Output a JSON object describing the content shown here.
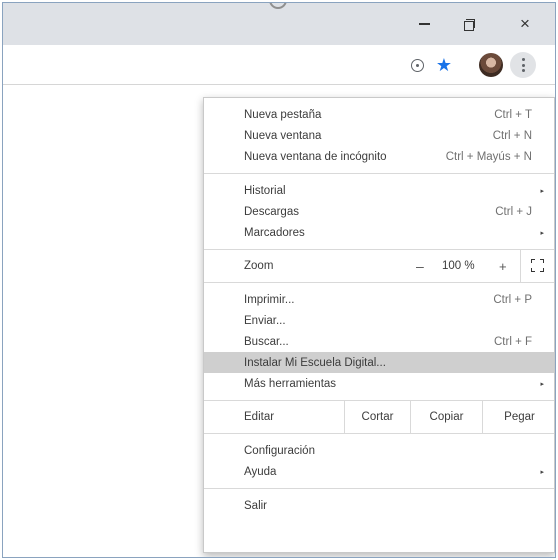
{
  "window": {
    "minimize_label": "–",
    "close_label": "×",
    "restore_icon": "restore-icon"
  },
  "toolbar": {
    "install_icon": "install-app-icon",
    "star_symbol": "★",
    "accent_color": "#1a73e8"
  },
  "menu": {
    "group1": [
      {
        "label": "Nueva pestaña",
        "shortcut": "Ctrl + T"
      },
      {
        "label": "Nueva ventana",
        "shortcut": "Ctrl + N"
      },
      {
        "label": "Nueva ventana de incógnito",
        "shortcut": "Ctrl + Mayús + N"
      }
    ],
    "group2": [
      {
        "label": "Historial",
        "arrow": "▸"
      },
      {
        "label": "Descargas",
        "shortcut": "Ctrl + J"
      },
      {
        "label": "Marcadores",
        "arrow": "▸"
      }
    ],
    "zoom": {
      "label": "Zoom",
      "minus": "–",
      "value": "100 %",
      "plus": "+"
    },
    "group3": [
      {
        "label": "Imprimir...",
        "shortcut": "Ctrl + P"
      },
      {
        "label": "Enviar..."
      },
      {
        "label": "Buscar...",
        "shortcut": "Ctrl + F"
      },
      {
        "label": "Instalar Mi Escuela Digital...",
        "highlighted": true
      },
      {
        "label": "Más herramientas",
        "arrow": "▸"
      }
    ],
    "edit": {
      "label": "Editar",
      "cut": "Cortar",
      "copy": "Copiar",
      "paste": "Pegar"
    },
    "group4": [
      {
        "label": "Configuración"
      },
      {
        "label": "Ayuda",
        "arrow": "▸"
      }
    ],
    "exit": {
      "label": "Salir"
    },
    "highlight_color": "#cfcfcf"
  }
}
